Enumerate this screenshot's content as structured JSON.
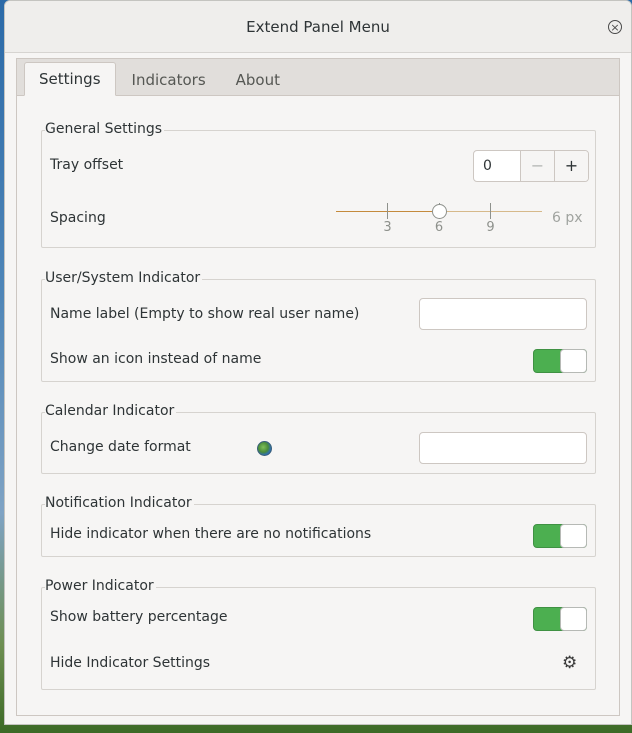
{
  "window": {
    "title": "Extend Panel Menu",
    "close_icon": "close-icon",
    "close_glyph": "×"
  },
  "tabs": [
    {
      "label": "Settings",
      "active": true
    },
    {
      "label": "Indicators",
      "active": false
    },
    {
      "label": "About",
      "active": false
    }
  ],
  "general": {
    "title": "General Settings",
    "tray_offset_label": "Tray offset",
    "tray_offset_value": "0",
    "minus": "−",
    "plus": "+",
    "spacing_label": "Spacing",
    "spacing_ticks": [
      "3",
      "6",
      "9"
    ],
    "spacing_value": "6 px",
    "spacing_level": 6,
    "spacing_range": [
      0,
      12
    ]
  },
  "user_system": {
    "title": "User/System Indicator",
    "name_label": "Name label (Empty to show real user name)",
    "name_value": "",
    "show_icon_label": "Show an icon instead of name",
    "show_icon_on": true
  },
  "calendar": {
    "title": "Calendar Indicator",
    "date_format_label": "Change date format",
    "date_format_icon": "globe-icon",
    "date_format_value": ""
  },
  "notification": {
    "title": "Notification Indicator",
    "hide_label": "Hide indicator when there are no notifications",
    "hide_on": true
  },
  "power": {
    "title": "Power Indicator",
    "battery_label": "Show battery percentage",
    "battery_on": true,
    "hide_settings_label": "Hide Indicator Settings",
    "gear_icon": "gear-icon",
    "gear_glyph": "⚙"
  },
  "colors": {
    "switch_on": "#4caf50",
    "slider_fill": "#c48a3c"
  }
}
